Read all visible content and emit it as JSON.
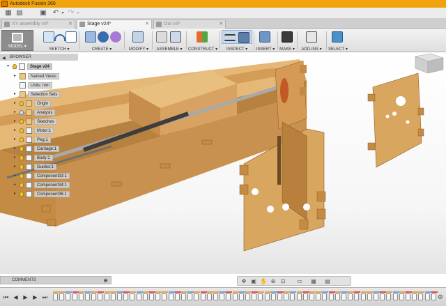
{
  "window": {
    "title": "Autodesk Fusion 360"
  },
  "quick_access": {
    "icons": [
      "app-menu-icon",
      "open-file-icon",
      "save-icon",
      "undo-icon",
      "redo-icon"
    ]
  },
  "tabs": [
    {
      "label": "XY assembly v3*",
      "active": false
    },
    {
      "label": "Stage v24*",
      "active": true
    },
    {
      "label": "Out v3*",
      "active": false
    }
  ],
  "ribbon": {
    "workspace_label": "MODEL ▾",
    "groups": [
      {
        "label": "SKETCH ▾"
      },
      {
        "label": "CREATE ▾"
      },
      {
        "label": "MODIFY ▾"
      },
      {
        "label": "ASSEMBLE ▾"
      },
      {
        "label": "CONSTRUCT ▾"
      },
      {
        "label": "INSPECT ▾"
      },
      {
        "label": "INSERT ▾"
      },
      {
        "label": "MAKE ▾"
      },
      {
        "label": "ADD-INS ▾"
      },
      {
        "label": "SELECT ▾"
      }
    ]
  },
  "browser": {
    "title": "BROWSER",
    "root": "Stage v24",
    "nodes": [
      {
        "label": "Named Views"
      },
      {
        "label": "Units: mm"
      },
      {
        "label": "Selection Sets"
      },
      {
        "label": "Origin"
      },
      {
        "label": "Analysis"
      },
      {
        "label": "Sketches"
      },
      {
        "label": "Motor:1"
      },
      {
        "label": "Peg:1"
      },
      {
        "label": "Carriage:1"
      },
      {
        "label": "Body:1"
      },
      {
        "label": "Guides:1"
      },
      {
        "label": "Component33:1"
      },
      {
        "label": "Component34:1"
      },
      {
        "label": "Component36:1"
      }
    ]
  },
  "comments": {
    "label": "COMMENTS"
  },
  "colors": {
    "titlebar": "#f0a30a",
    "wood": "#d9a55e",
    "wood_dark": "#b07a37",
    "rod": "#9a9a9a",
    "selection_highlight": "#8fb1d8"
  }
}
